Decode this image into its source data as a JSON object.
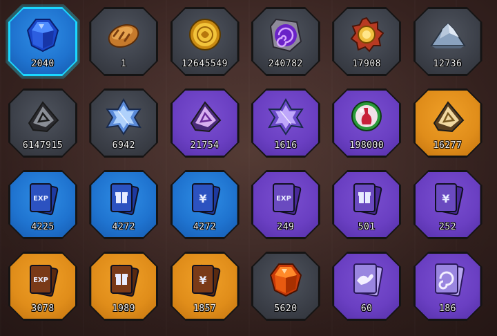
{
  "inventory": {
    "items": [
      {
        "name": "blue-gem",
        "icon": "blue-gem-icon",
        "rarity": "blue",
        "qty": "2040",
        "selected": true
      },
      {
        "name": "bread",
        "icon": "bread-icon",
        "rarity": "grey",
        "qty": "1"
      },
      {
        "name": "gold-coin",
        "icon": "gold-coin-icon",
        "rarity": "grey",
        "qty": "12645549"
      },
      {
        "name": "purple-shield",
        "icon": "swirl-shield-icon",
        "rarity": "grey",
        "qty": "240782"
      },
      {
        "name": "medal",
        "icon": "sun-medal-icon",
        "rarity": "grey",
        "qty": "17908"
      },
      {
        "name": "ore-pile",
        "icon": "ore-pile-icon",
        "rarity": "grey",
        "qty": "12736"
      },
      {
        "name": "grey-rune-stone",
        "icon": "triangle-rune-icon",
        "rarity": "grey",
        "qty": "6147915"
      },
      {
        "name": "star-crystal-grey",
        "icon": "hexagram-icon",
        "rarity": "grey",
        "qty": "6942"
      },
      {
        "name": "purple-rune-stone",
        "icon": "triangle-rune-icon",
        "rarity": "purple",
        "qty": "21754"
      },
      {
        "name": "star-crystal-purple",
        "icon": "hexagram-icon",
        "rarity": "purple",
        "qty": "1616"
      },
      {
        "name": "potion-orb",
        "icon": "potion-orb-icon",
        "rarity": "purple",
        "qty": "198000"
      },
      {
        "name": "gold-rune-stone",
        "icon": "triangle-rune-icon",
        "rarity": "orange",
        "qty": "16277"
      },
      {
        "name": "exp-card-blue",
        "icon": "exp-card-icon",
        "rarity": "blue",
        "qty": "4225"
      },
      {
        "name": "gift-card-blue",
        "icon": "gift-card-icon",
        "rarity": "blue",
        "qty": "4272"
      },
      {
        "name": "yen-card-blue",
        "icon": "yen-card-icon",
        "rarity": "blue",
        "qty": "4272"
      },
      {
        "name": "exp-card-purple",
        "icon": "exp-card-icon",
        "rarity": "purple",
        "qty": "249"
      },
      {
        "name": "gift-card-purple",
        "icon": "gift-card-icon",
        "rarity": "purple",
        "qty": "501"
      },
      {
        "name": "yen-card-purple",
        "icon": "yen-card-icon",
        "rarity": "purple",
        "qty": "252"
      },
      {
        "name": "exp-card-orange",
        "icon": "exp-card-icon",
        "rarity": "orange",
        "qty": "3078"
      },
      {
        "name": "gift-card-orange",
        "icon": "gift-card-icon",
        "rarity": "orange",
        "qty": "1989"
      },
      {
        "name": "yen-card-orange",
        "icon": "yen-card-icon",
        "rarity": "orange",
        "qty": "1857"
      },
      {
        "name": "orange-gem",
        "icon": "orange-gem-icon",
        "rarity": "grey",
        "qty": "5620"
      },
      {
        "name": "spirit-card-1",
        "icon": "spirit-card-icon",
        "rarity": "purple",
        "qty": "60"
      },
      {
        "name": "spirit-card-2",
        "icon": "swirl-card-icon",
        "rarity": "purple",
        "qty": "186"
      }
    ],
    "card_texts": {
      "exp": "EXP",
      "yen": "¥"
    }
  },
  "colors": {
    "selected_glow": "#1bd7ff",
    "grey": "#7b7f8a",
    "purple": "#b698ff",
    "blue": "#6ec7ff",
    "orange": "#ffd27a"
  }
}
